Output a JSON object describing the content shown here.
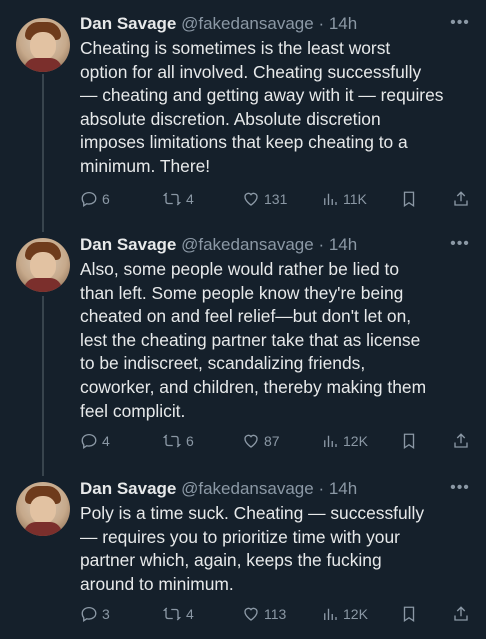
{
  "colors": {
    "background": "#15202b",
    "text": "#e7e9ea",
    "secondary": "#8b98a5",
    "thread_line": "#38444d"
  },
  "tweets": [
    {
      "name": "Dan Savage",
      "handle": "@fakedansavage",
      "time": "· 14h",
      "lines": [
        "Cheating is sometimes is the least worst",
        "option for all involved. Cheating successfully",
        "— cheating and getting away with it — requires",
        "absolute discretion. Absolute discretion",
        "imposes limitations that keep cheating to a",
        "minimum. There!"
      ],
      "replies": "6",
      "retweets": "4",
      "likes": "131",
      "views": "11K"
    },
    {
      "name": "Dan Savage",
      "handle": "@fakedansavage",
      "time": "· 14h",
      "lines": [
        "Also, some people would rather be lied to",
        "than left. Some people know they're being",
        "cheated on and feel relief—but don't let on,",
        "lest the cheating partner take that as license",
        "to be indiscreet, scandalizing friends,",
        "coworker, and children, thereby making them",
        "feel complicit."
      ],
      "replies": "4",
      "retweets": "6",
      "likes": "87",
      "views": "12K"
    },
    {
      "name": "Dan Savage",
      "handle": "@fakedansavage",
      "time": "· 14h",
      "lines": [
        "Poly is a time suck. Cheating — successfully",
        "— requires you to prioritize time with your",
        "partner which, again, keeps the fucking",
        "around to minimum."
      ],
      "replies": "3",
      "retweets": "4",
      "likes": "113",
      "views": "12K"
    }
  ],
  "icons": {
    "avatar": "profile-photo",
    "more": "more-dots-icon",
    "reply": "reply-icon",
    "retweet": "retweet-icon",
    "like": "heart-icon",
    "views": "views-icon",
    "bookmark": "bookmark-icon",
    "share": "share-icon"
  }
}
